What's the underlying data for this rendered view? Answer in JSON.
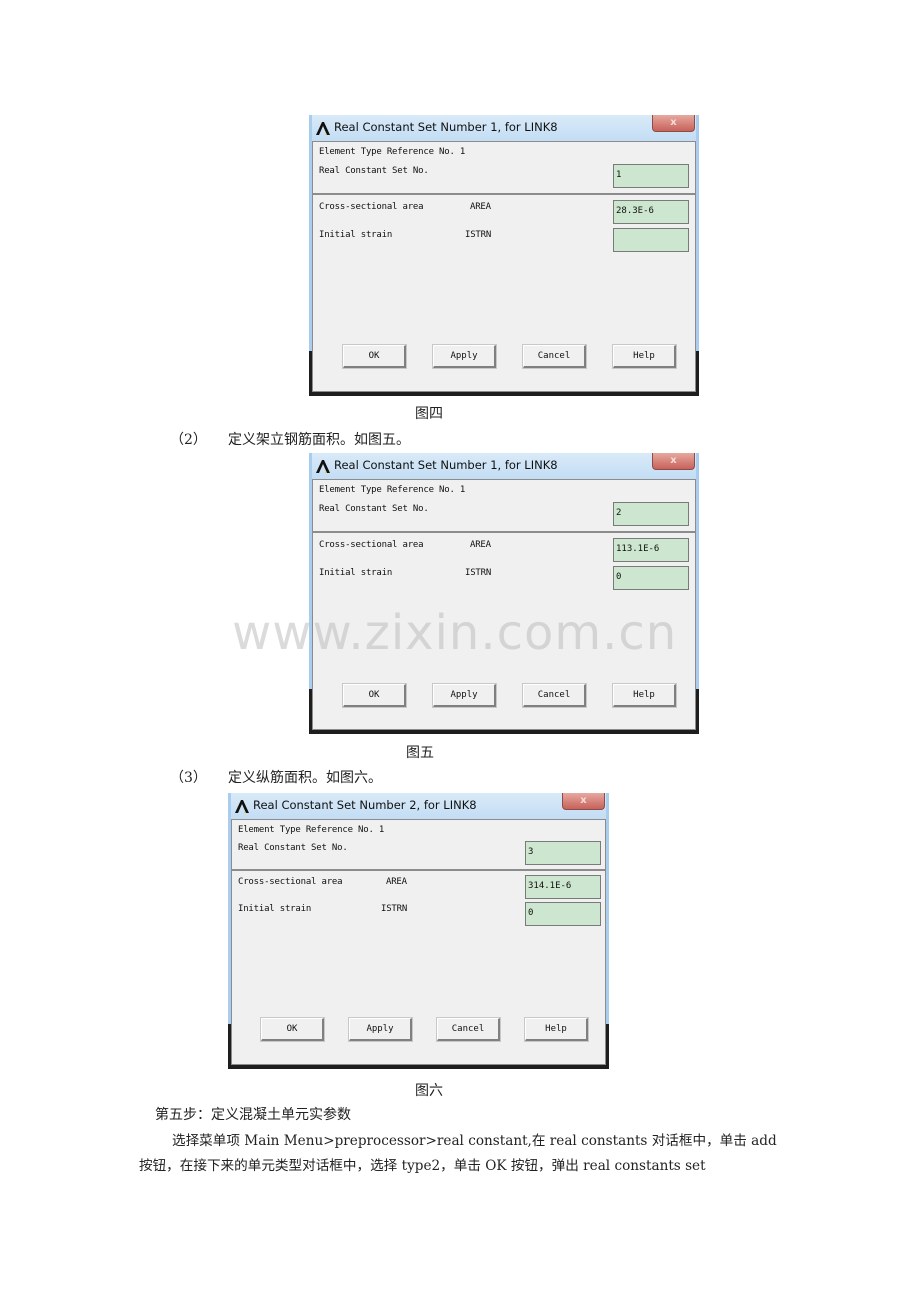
{
  "dialogs": [
    {
      "title": "Real Constant Set Number 1, for LINK8",
      "close_label": "x",
      "elem_type_ref": "Element Type Reference No. 1",
      "set_no_label": "Real Constant Set No.",
      "set_no_value": "1",
      "rows": [
        {
          "label": "Cross-sectional area",
          "code": "AREA",
          "value": "28.3E-6"
        },
        {
          "label": "Initial strain",
          "code": "ISTRN",
          "value": ""
        }
      ],
      "buttons": {
        "ok": "OK",
        "apply": "Apply",
        "cancel": "Cancel",
        "help": "Help"
      }
    },
    {
      "title": "Real Constant Set Number 1, for LINK8",
      "close_label": "x",
      "elem_type_ref": "Element Type Reference No. 1",
      "set_no_label": "Real Constant Set No.",
      "set_no_value": "2",
      "rows": [
        {
          "label": "Cross-sectional area",
          "code": "AREA",
          "value": "113.1E-6"
        },
        {
          "label": "Initial strain",
          "code": "ISTRN",
          "value": "0"
        }
      ],
      "buttons": {
        "ok": "OK",
        "apply": "Apply",
        "cancel": "Cancel",
        "help": "Help"
      }
    },
    {
      "title": "Real Constant Set Number 2, for LINK8",
      "close_label": "x",
      "elem_type_ref": "Element Type Reference No. 1",
      "set_no_label": "Real Constant Set No.",
      "set_no_value": "3",
      "rows": [
        {
          "label": "Cross-sectional area",
          "code": "AREA",
          "value": "314.1E-6"
        },
        {
          "label": "Initial strain",
          "code": "ISTRN",
          "value": "0"
        }
      ],
      "buttons": {
        "ok": "OK",
        "apply": "Apply",
        "cancel": "Cancel",
        "help": "Help"
      }
    }
  ],
  "captions": {
    "fig4": "图四",
    "fig5": "图五",
    "fig6": "图六"
  },
  "steps": {
    "step2_num": "（2）",
    "step2_text": "定义架立钢筋面积。如图五。",
    "step3_num": "（3）",
    "step3_text": "定义纵筋面积。如图六。"
  },
  "section": {
    "heading": "第五步：定义混凝土单元实参数",
    "line1": "选择菜单项 Main Menu>preprocessor>real constant,在 real constants 对话框中，单击 add",
    "line2": "按钮，在接下来的单元类型对话框中，选择 type2，单击 OK 按钮，弹出 real constants set"
  },
  "watermark": "www.zixin.com.cn"
}
